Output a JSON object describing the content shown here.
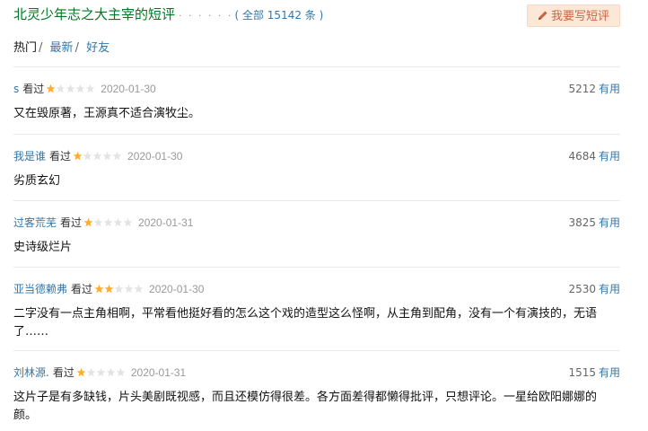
{
  "header": {
    "title": "北灵少年志之大主宰的短评",
    "dots": "· · · · · ·",
    "total_prefix": "( ",
    "total_link": "全部 15142 条",
    "total_suffix": " )",
    "write_button": "我要写短评"
  },
  "tabs": [
    {
      "label": "热门",
      "active": true
    },
    {
      "label": "最新",
      "active": false
    },
    {
      "label": "好友",
      "active": false
    }
  ],
  "tab_separator": "/",
  "colors": {
    "title_green": "#007722",
    "link_blue": "#3377aa",
    "star_gold": "#ffac2d",
    "button_bg": "#fde8d8",
    "button_text": "#ca6445"
  },
  "comments": [
    {
      "user": "s",
      "status": "看过",
      "rating": 1,
      "date": "2020-01-30",
      "votes": "5212",
      "vote_label": "有用",
      "text": "又在毁原著，王源真不适合演牧尘。"
    },
    {
      "user": "我是谁",
      "status": "看过",
      "rating": 1,
      "date": "2020-01-30",
      "votes": "4684",
      "vote_label": "有用",
      "text": "劣质玄幻"
    },
    {
      "user": "过客荒芜",
      "status": "看过",
      "rating": 1,
      "date": "2020-01-31",
      "votes": "3825",
      "vote_label": "有用",
      "text": "史诗级烂片"
    },
    {
      "user": "亚当德赖弗",
      "status": "看过",
      "rating": 2,
      "date": "2020-01-30",
      "votes": "2530",
      "vote_label": "有用",
      "text": "二字没有一点主角相啊，平常看他挺好看的怎么这个戏的造型这么怪啊，从主角到配角，没有一个有演技的，无语了……"
    },
    {
      "user": "刘林源.",
      "status": "看过",
      "rating": 1,
      "date": "2020-01-31",
      "votes": "1515",
      "vote_label": "有用",
      "text": "这片子是有多缺钱，片头美剧既视感，而且还模仿得很差。各方面差得都懒得批评，只想评论。一星给欧阳娜娜的颜。"
    }
  ]
}
